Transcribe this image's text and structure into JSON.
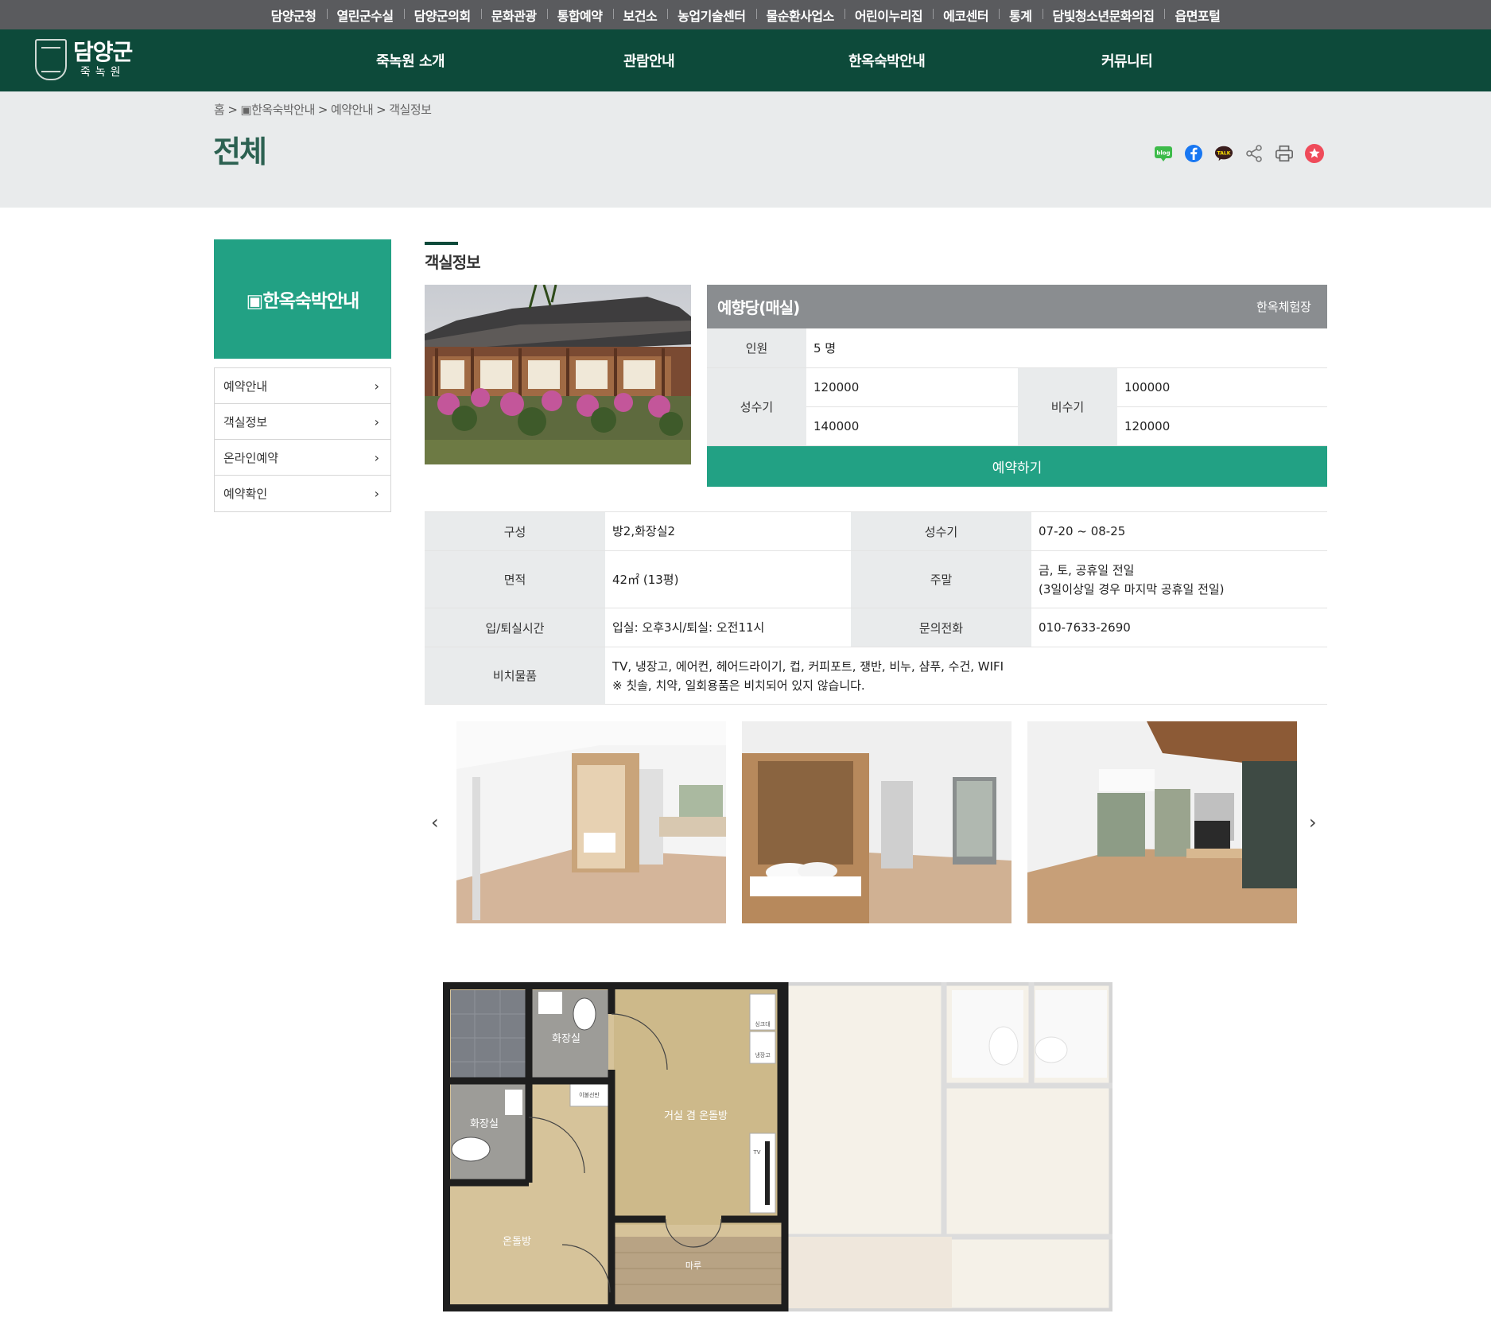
{
  "util_links": [
    "담양군청",
    "열린군수실",
    "담양군의회",
    "문화관광",
    "통합예약",
    "보건소",
    "농업기술센터",
    "물순환사업소",
    "어린이누리집",
    "에코센터",
    "통계",
    "담빛청소년문화의집",
    "읍면포털"
  ],
  "logo": {
    "main": "담양군",
    "sub": "죽녹원"
  },
  "gnb": [
    "죽녹원 소개",
    "관람안내",
    "한옥숙박안내",
    "커뮤니티"
  ],
  "breadcrumb": [
    "홈",
    "▣한옥숙박안내",
    "예약안내",
    "객실정보"
  ],
  "page_title": "전체",
  "share_icons": [
    "blog-icon",
    "facebook-icon",
    "kakaotalk-icon",
    "share-icon",
    "print-icon",
    "favorite-star-icon"
  ],
  "share_labels": {
    "blog": "blog",
    "talk": "TALK"
  },
  "sidebar": {
    "title": "▣한옥숙박안내",
    "items": [
      "예약안내",
      "객실정보",
      "온라인예약",
      "예약확인"
    ]
  },
  "section_title": "객실정보",
  "room": {
    "name": "예향당(매실)",
    "type": "한옥체험장",
    "capacity_label": "인원",
    "capacity": "5 명",
    "peak_label": "성수기",
    "peak_prices": [
      "120000",
      "140000"
    ],
    "offpeak_label": "비수기",
    "offpeak_prices": [
      "100000",
      "120000"
    ],
    "reserve_label": "예약하기"
  },
  "details": {
    "composition_label": "구성",
    "composition": "방2,화장실2",
    "peak_label": "성수기",
    "peak_period": "07-20 ~ 08-25",
    "area_label": "면적",
    "area": "42㎡ (13평)",
    "weekend_label": "주말",
    "weekend_line1": "금, 토, 공휴일 전일",
    "weekend_line2": "(3일이상일 경우 마지막 공휴일 전일)",
    "checkin_label": "입/퇴실시간",
    "checkin": "입실: 오후3시/퇴실: 오전11시",
    "phone_label": "문의전화",
    "phone": "010-7633-2690",
    "amenities_label": "비치물품",
    "amenities_line1": "TV, 냉장고, 에어컨, 헤어드라이기, 컵, 커피포트, 쟁반, 비누, 샴푸, 수건, WIFI",
    "amenities_line2": "※ 칫솔, 치약, 일회용품은 비치되어 있지 않습니다."
  },
  "gallery": {
    "prev": "‹",
    "next": "›"
  },
  "floorplan": {
    "labels": [
      "화장실",
      "화장실",
      "거실 겸 온돌방",
      "온돌방",
      "마루",
      "싱크대",
      "냉장고",
      "이불선반",
      "TV"
    ]
  }
}
